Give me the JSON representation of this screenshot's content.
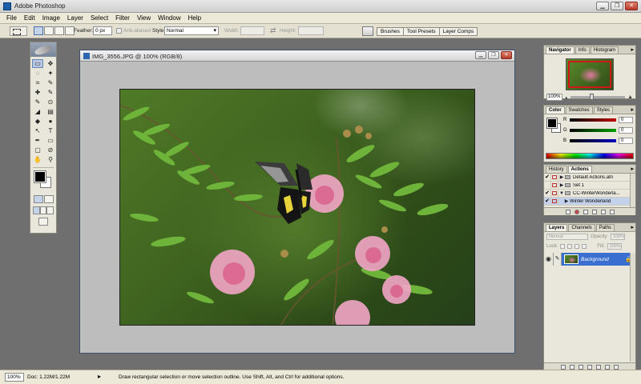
{
  "window": {
    "title": "Adobe Photoshop"
  },
  "menubar": {
    "items": [
      "File",
      "Edit",
      "Image",
      "Layer",
      "Select",
      "Filter",
      "View",
      "Window",
      "Help"
    ]
  },
  "options": {
    "feather_label": "Feather:",
    "feather_value": "0 px",
    "antialias_label": "Anti-aliased",
    "style_label": "Style:",
    "style_value": "Normal",
    "width_label": "Width:",
    "height_label": "Height:"
  },
  "palette_well": {
    "tabs": [
      "Brushes",
      "Tool Presets",
      "Layer Comps"
    ]
  },
  "toolbox": {
    "tools": [
      "▭",
      "✥",
      "◌",
      "✦",
      "⌗",
      "✎",
      "✚",
      "✎",
      "✎",
      "⊙",
      "◢",
      "▤",
      "◆",
      "●",
      "↖",
      "T",
      "✒",
      "▭",
      "▢",
      "⊘",
      "✋",
      "⚲"
    ]
  },
  "document": {
    "title": "IMG_3556.JPG @ 100% (RGB/8)"
  },
  "navigator": {
    "tabs": [
      "Navigator",
      "Info",
      "Histogram"
    ],
    "zoom": "100%"
  },
  "color_panel": {
    "tabs": [
      "Color",
      "Swatches",
      "Styles"
    ],
    "channels": [
      {
        "label": "R",
        "value": "0"
      },
      {
        "label": "G",
        "value": "0"
      },
      {
        "label": "B",
        "value": "0"
      }
    ],
    "colors": {
      "red_bar": "#c00000",
      "green_bar": "#00a000",
      "blue_bar": "#0000c0"
    }
  },
  "actions_panel": {
    "tabs": [
      "History",
      "Actions"
    ],
    "rows": [
      {
        "check": "✔",
        "text": "Default Actions.atn",
        "folder": true,
        "selected": false,
        "indent": 0
      },
      {
        "check": "",
        "text": "Set 1",
        "folder": true,
        "selected": false,
        "indent": 0
      },
      {
        "check": "✔",
        "text": "CC-WinterWonderla...",
        "folder": true,
        "selected": false,
        "indent": 0
      },
      {
        "check": "✔",
        "text": "Winter Wonderland",
        "folder": false,
        "selected": true,
        "indent": 1
      }
    ]
  },
  "layers_panel": {
    "tabs": [
      "Layers",
      "Channels",
      "Paths"
    ],
    "blend_mode": "Normal",
    "opacity_label": "Opacity:",
    "opacity_value": "100%",
    "lock_label": "Lock:",
    "fill_label": "Fill:",
    "fill_value": "100%",
    "layer_name": "Background"
  },
  "statusbar": {
    "zoom": "100%",
    "doc_info": "Doc: 1.22M/1.22M",
    "hint": "Draw rectangular selection or move selection outline.  Use Shift, Alt, and Ctrl for additional options."
  }
}
